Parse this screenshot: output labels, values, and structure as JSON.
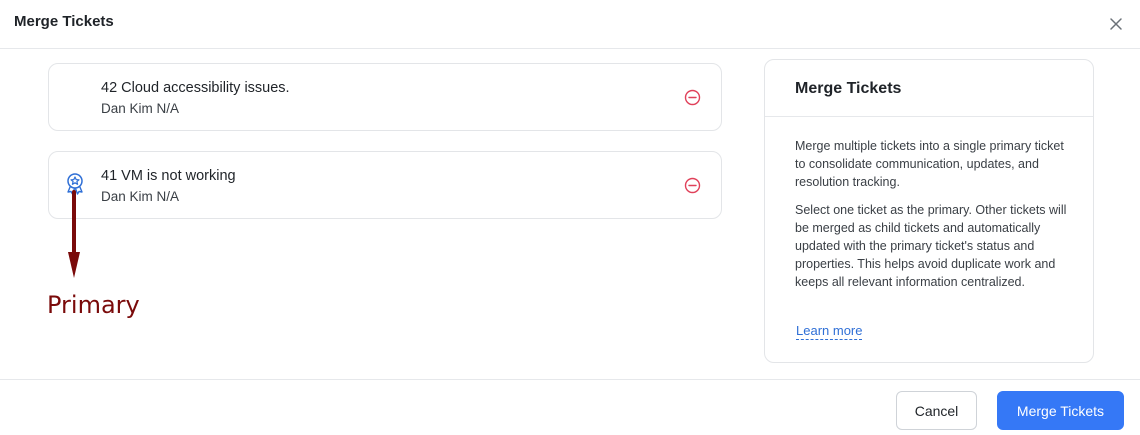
{
  "modal": {
    "title": "Merge Tickets",
    "close_icon": "close-icon"
  },
  "tickets": [
    {
      "title": "42 Cloud accessibility issues.",
      "subtitle": "Dan Kim N/A",
      "primary": false,
      "remove_icon": "minus-circle-icon"
    },
    {
      "title": "41 VM is not working",
      "subtitle": "Dan Kim N/A",
      "primary": true,
      "primary_icon": "award-badge-icon",
      "remove_icon": "minus-circle-icon"
    }
  ],
  "annotation": {
    "label": "Primary",
    "color": "#7a0a0a"
  },
  "info_panel": {
    "title": "Merge Tickets",
    "paragraph_1": "Merge multiple tickets into a single primary ticket to consolidate communication, updates, and resolution tracking.",
    "paragraph_2": "Select one ticket as the primary. Other tickets will be merged as child tickets and automatically updated with the primary ticket's status and properties. This helps avoid duplicate work and keeps all relevant information centralized.",
    "link": "Learn more"
  },
  "footer": {
    "cancel_label": "Cancel",
    "merge_label": "Merge Tickets"
  },
  "colors": {
    "accent": "#3578f6",
    "remove": "#e0415a",
    "link": "#2f6fd6"
  }
}
